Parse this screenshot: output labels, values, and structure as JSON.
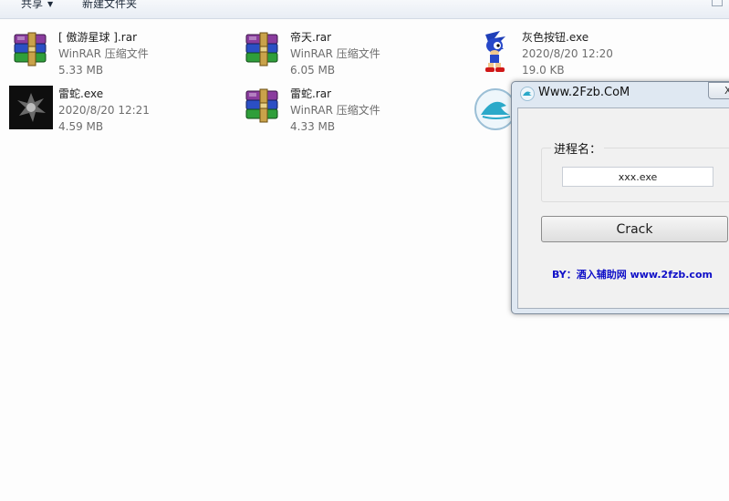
{
  "toolbar": {
    "share_label": "共享",
    "new_folder_label": "新建文件夹"
  },
  "files": [
    {
      "name": "[ 傲游星球 ].rar",
      "meta1": "WinRAR 压缩文件",
      "meta2": "5.33 MB",
      "icon": "winrar-icon"
    },
    {
      "name": "帝天.rar",
      "meta1": "WinRAR 压缩文件",
      "meta2": "6.05 MB",
      "icon": "winrar-icon"
    },
    {
      "name": "灰色按钮.exe",
      "meta1": "2020/8/20 12:20",
      "meta2": "19.0 KB",
      "icon": "sonic-icon"
    },
    {
      "name": "雷蛇.exe",
      "meta1": "2020/8/20 12:21",
      "meta2": "4.59 MB",
      "icon": "razer-icon"
    },
    {
      "name": "雷蛇.rar",
      "meta1": "WinRAR 压缩文件",
      "meta2": "4.33 MB",
      "icon": "winrar-icon"
    }
  ],
  "dialog": {
    "title": "Www.2Fzb.CoM",
    "close_label": "X",
    "group_label": "进程名：",
    "process_value": "xxx.exe",
    "crack_label": "Crack",
    "credit": "BY：酒入辅助网 www.2fzb.com"
  },
  "colors": {
    "credit": "#1010c8",
    "dialog_frame": "#dfe8f2"
  }
}
